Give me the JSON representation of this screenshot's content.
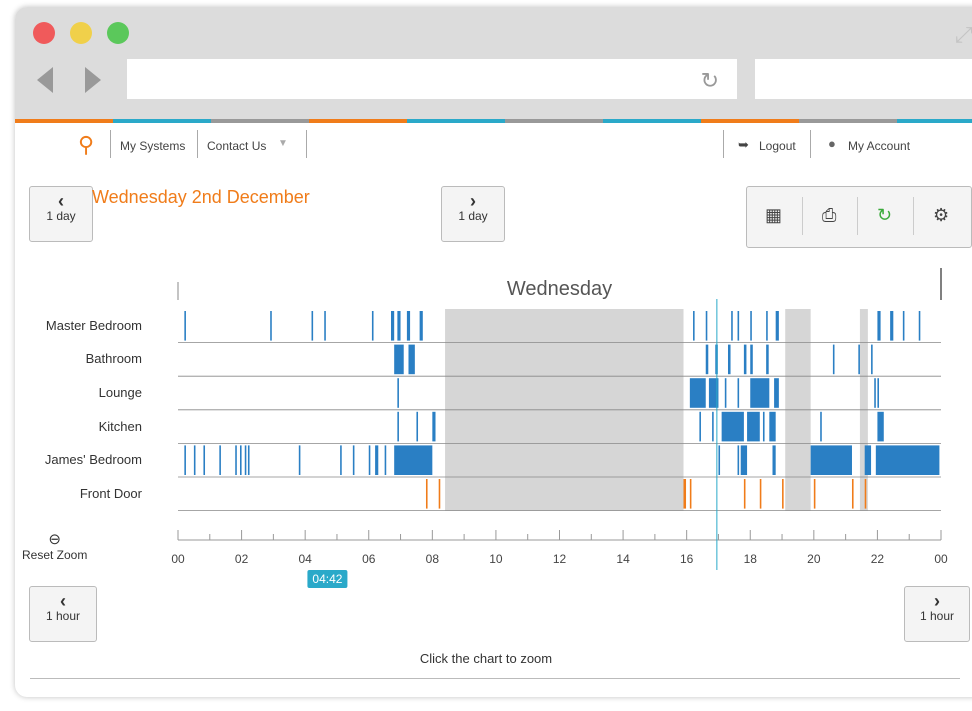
{
  "browser": {
    "colors": {
      "close": "#f05a5b",
      "minimize": "#f0d04a",
      "zoom": "#5bc85b"
    }
  },
  "header": {
    "nav": {
      "my_systems": "My Systems",
      "contact_us": "Contact Us",
      "logout": "Logout",
      "my_account": "My Account"
    },
    "accent": "#f07c1a"
  },
  "day_nav": {
    "prev_label": "1 day",
    "next_label": "1 day",
    "date_title": "Wednesday 2nd December"
  },
  "toolbar": {
    "icons": [
      "calendar-icon",
      "print-icon",
      "refresh-icon",
      "gear-icon"
    ]
  },
  "hour_nav": {
    "prev_label": "1 hour",
    "next_label": "1 hour"
  },
  "zoom": {
    "reset_label": "Reset Zoom"
  },
  "footer": {
    "hint": "Click the chart to zoom"
  },
  "chart_data": {
    "type": "timeline",
    "title": "Wednesday",
    "x_range": [
      0,
      24
    ],
    "x_ticks": [
      "00",
      "02",
      "04",
      "06",
      "08",
      "10",
      "12",
      "14",
      "16",
      "18",
      "20",
      "22",
      "00"
    ],
    "cursor": {
      "time": 16.95,
      "label": "04:42",
      "label_time": 4.7
    },
    "rows": [
      {
        "name": "Master Bedroom",
        "color": "#2a7fc4",
        "events": [
          [
            0.2,
            0.05
          ],
          [
            2.9,
            0.05
          ],
          [
            4.2,
            0.05
          ],
          [
            4.6,
            0.05
          ],
          [
            6.1,
            0.05
          ],
          [
            6.7,
            0.1
          ],
          [
            6.9,
            0.1
          ],
          [
            7.2,
            0.1
          ],
          [
            7.6,
            0.1
          ],
          [
            16.2,
            0.05
          ],
          [
            16.6,
            0.05
          ],
          [
            17.4,
            0.05
          ],
          [
            17.6,
            0.05
          ],
          [
            18.0,
            0.05
          ],
          [
            18.5,
            0.05
          ],
          [
            18.8,
            0.1
          ],
          [
            22.0,
            0.1
          ],
          [
            22.4,
            0.1
          ],
          [
            22.8,
            0.05
          ],
          [
            23.3,
            0.05
          ]
        ]
      },
      {
        "name": "Bathroom",
        "color": "#2a7fc4",
        "events": [
          [
            6.8,
            0.3
          ],
          [
            7.25,
            0.2
          ],
          [
            16.6,
            0.08
          ],
          [
            16.9,
            0.08
          ],
          [
            17.3,
            0.08
          ],
          [
            17.8,
            0.08
          ],
          [
            18.0,
            0.08
          ],
          [
            18.5,
            0.08
          ],
          [
            20.6,
            0.05
          ],
          [
            21.4,
            0.05
          ],
          [
            21.8,
            0.05
          ]
        ]
      },
      {
        "name": "Lounge",
        "color": "#2a7fc4",
        "events": [
          [
            6.9,
            0.05
          ],
          [
            16.1,
            0.5
          ],
          [
            16.7,
            0.3
          ],
          [
            17.2,
            0.05
          ],
          [
            17.6,
            0.05
          ],
          [
            18.0,
            0.6
          ],
          [
            18.75,
            0.15
          ],
          [
            21.9,
            0.05
          ],
          [
            22.0,
            0.05
          ]
        ]
      },
      {
        "name": "Kitchen",
        "color": "#2a7fc4",
        "events": [
          [
            6.9,
            0.05
          ],
          [
            7.5,
            0.05
          ],
          [
            8.0,
            0.1
          ],
          [
            16.4,
            0.05
          ],
          [
            16.8,
            0.05
          ],
          [
            17.1,
            0.7
          ],
          [
            17.9,
            0.4
          ],
          [
            18.4,
            0.05
          ],
          [
            18.6,
            0.2
          ],
          [
            20.2,
            0.05
          ],
          [
            22.0,
            0.2
          ]
        ]
      },
      {
        "name": "James' Bedroom",
        "color": "#2a7fc4",
        "events": [
          [
            0.2,
            0.05
          ],
          [
            0.5,
            0.05
          ],
          [
            0.8,
            0.05
          ],
          [
            1.3,
            0.05
          ],
          [
            1.8,
            0.05
          ],
          [
            1.95,
            0.05
          ],
          [
            2.1,
            0.05
          ],
          [
            2.2,
            0.05
          ],
          [
            3.8,
            0.05
          ],
          [
            5.1,
            0.05
          ],
          [
            5.5,
            0.05
          ],
          [
            6.0,
            0.05
          ],
          [
            6.2,
            0.1
          ],
          [
            6.5,
            0.05
          ],
          [
            6.8,
            1.2
          ],
          [
            17.0,
            0.05
          ],
          [
            17.6,
            0.05
          ],
          [
            17.7,
            0.2
          ],
          [
            18.7,
            0.1
          ],
          [
            19.9,
            1.3
          ],
          [
            21.6,
            0.2
          ],
          [
            21.95,
            2.0
          ]
        ]
      },
      {
        "name": "Front Door",
        "color": "#f07c1a",
        "events": [
          [
            7.8,
            0.05
          ],
          [
            8.2,
            0.05
          ],
          [
            15.9,
            0.08
          ],
          [
            16.1,
            0.05
          ],
          [
            17.8,
            0.05
          ],
          [
            18.3,
            0.05
          ],
          [
            19.0,
            0.05
          ],
          [
            20.0,
            0.05
          ],
          [
            21.2,
            0.05
          ],
          [
            21.6,
            0.05
          ]
        ]
      }
    ],
    "shaded_ranges": [
      [
        8.4,
        15.9
      ],
      [
        19.1,
        19.9
      ],
      [
        21.45,
        21.7
      ]
    ],
    "colors": {
      "shade": "#d6d6d6",
      "grid": "#888888",
      "cursor": "#2aa9c9"
    }
  }
}
